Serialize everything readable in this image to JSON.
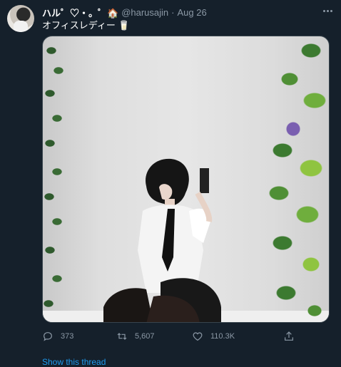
{
  "tweet": {
    "display_name": "ハル゜♡・。゜🏠",
    "handle": "@harusajin",
    "separator": "·",
    "date": "Aug 26",
    "text": "オフィスレディー 🥛",
    "media_description_icon": "photo-icon"
  },
  "actions": {
    "replies": "373",
    "retweets": "5,607",
    "likes": "110.3K"
  },
  "footer": {
    "show_thread": "Show this thread"
  },
  "colors": {
    "background": "#15202b",
    "muted": "#8b98a5",
    "link": "#1d9bf0"
  }
}
